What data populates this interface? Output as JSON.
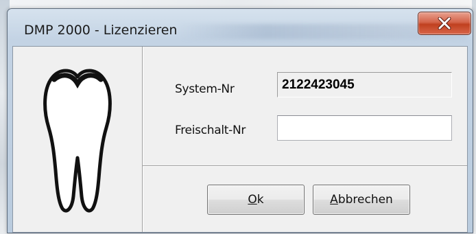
{
  "window": {
    "title": "DMP 2000 - Lizenzieren",
    "close_icon": "close-x-icon",
    "close_color": "#c7482a"
  },
  "dialog": {
    "logo_icon": "tooth-icon",
    "system_label": "System-Nr",
    "system_value": "2122423045",
    "unlock_label": "Freischalt-Nr",
    "unlock_value": ""
  },
  "buttons": {
    "ok_mnemonic": "O",
    "ok_rest": "k",
    "cancel_mnemonic": "A",
    "cancel_rest": "bbrechen"
  }
}
